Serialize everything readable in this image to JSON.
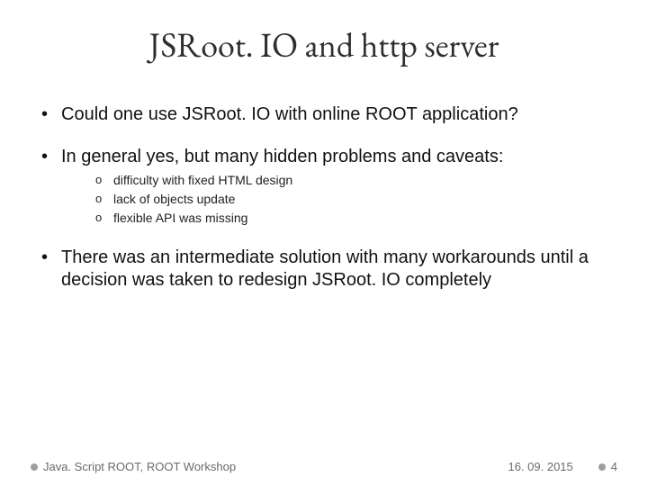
{
  "title": "JSRoot. IO and http server",
  "bullets": {
    "b1": "Could one use JSRoot. IO with online ROOT application?",
    "b2": "In general yes, but many hidden problems and caveats:",
    "b3": "There was an intermediate solution with many workarounds until a decision was taken to redesign JSRoot. IO completely",
    "sub": {
      "s1": "difficulty with fixed HTML design",
      "s2": "lack of objects update",
      "s3": "flexible API was missing"
    }
  },
  "footer": {
    "left": "Java. Script ROOT, ROOT Workshop",
    "date": "16. 09. 2015",
    "page": "4"
  }
}
